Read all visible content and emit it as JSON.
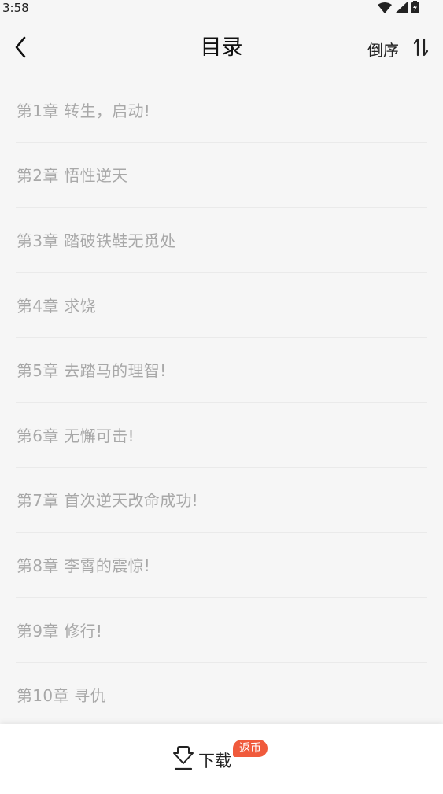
{
  "status_bar": {
    "time": "3:58",
    "icons": [
      "wifi-icon",
      "signal-icon",
      "battery-charging-icon"
    ]
  },
  "header": {
    "back_icon": "chevron-left-icon",
    "title": "目录",
    "sort_label": "倒序",
    "sort_icon": "sort-arrows-icon"
  },
  "chapters": [
    "第1章 转生，启动!",
    "第2章 悟性逆天",
    "第3章 踏破铁鞋无觅处",
    "第4章 求饶",
    "第5章 去踏马的理智!",
    "第6章 无懈可击!",
    "第7章 首次逆天改命成功!",
    "第8章 李霄的震惊!",
    "第9章 修行!",
    "第10章 寻仇"
  ],
  "bottom_bar": {
    "download_icon": "download-icon",
    "download_label": "下载",
    "badge": "返币"
  },
  "colors": {
    "background": "#f6f6f6",
    "chapter_text": "#a8a8a8",
    "badge": "#f05a3c"
  }
}
